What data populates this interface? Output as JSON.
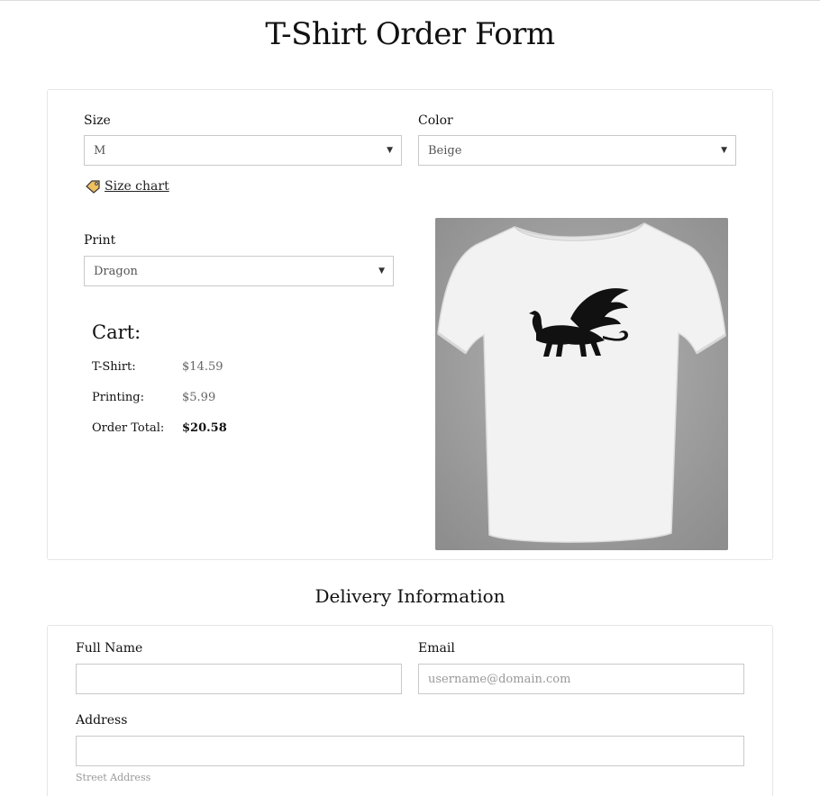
{
  "page": {
    "title": "T-Shirt Order Form"
  },
  "product": {
    "size": {
      "label": "Size",
      "value": "M"
    },
    "color": {
      "label": "Color",
      "value": "Beige"
    },
    "size_chart": {
      "label": "Size chart",
      "icon": "price-tag-icon"
    },
    "print": {
      "label": "Print",
      "value": "Dragon"
    },
    "image": {
      "subject": "white t-shirt with black dragon print on grey background"
    }
  },
  "cart": {
    "title": "Cart:",
    "rows": [
      {
        "label": "T-Shirt:",
        "value": "$14.59"
      },
      {
        "label": "Printing:",
        "value": "$5.99"
      },
      {
        "label": "Order Total:",
        "value": "$20.58"
      }
    ]
  },
  "delivery": {
    "title": "Delivery Information",
    "full_name": {
      "label": "Full Name",
      "value": "",
      "placeholder": ""
    },
    "email": {
      "label": "Email",
      "value": "",
      "placeholder": "username@domain.com"
    },
    "address": {
      "label": "Address",
      "value": "",
      "placeholder": "",
      "sublabel": "Street Address"
    }
  },
  "colors": {
    "border": "#c9c9c9",
    "card_border": "#e6e6e6",
    "photo_bg": "#9c9c9c",
    "shirt": "#f2f2f2",
    "print": "#111111"
  }
}
